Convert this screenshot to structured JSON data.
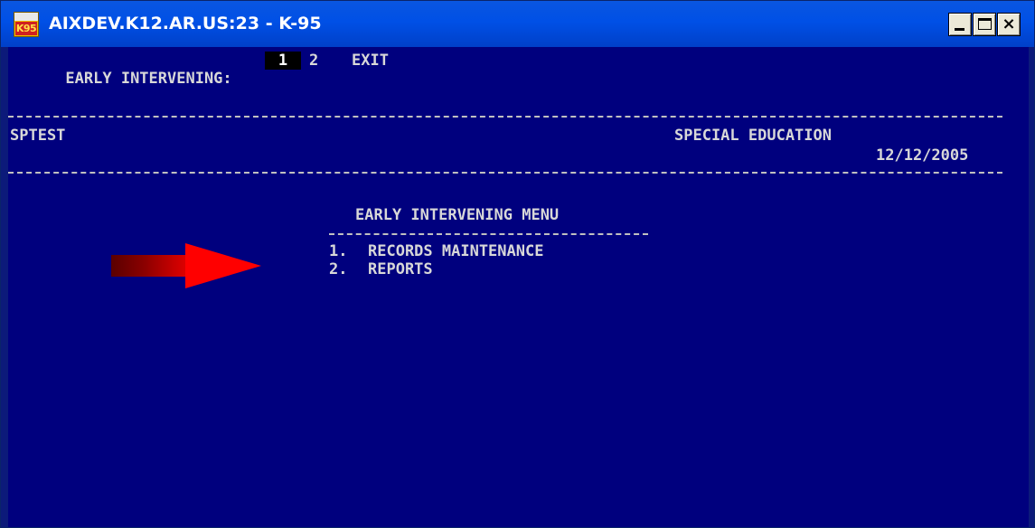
{
  "window": {
    "title": "AIXDEV.K12.AR.US:23 - K-95",
    "icon_label": "K95",
    "colors": {
      "titlebar": "#0050e6",
      "terminal_bg": "#00007e",
      "terminal_text": "#d8d8d8",
      "arrow": "#ff0000"
    }
  },
  "controls": {
    "minimize": "_",
    "maximize": "□",
    "close": "×"
  },
  "terminal": {
    "menu_bar": {
      "label": "EARLY INTERVENING:",
      "options": [
        "1",
        "2",
        "EXIT"
      ],
      "selected": "1"
    },
    "header": {
      "left": "SPTEST",
      "right": "SPECIAL EDUCATION",
      "date": "12/12/2005"
    },
    "menu": {
      "title": "EARLY INTERVENING MENU",
      "items": [
        {
          "number": "1.",
          "label": "RECORDS MAINTENANCE"
        },
        {
          "number": "2.",
          "label": "REPORTS"
        }
      ]
    }
  },
  "annotation": {
    "icon": "red-arrow-icon"
  }
}
